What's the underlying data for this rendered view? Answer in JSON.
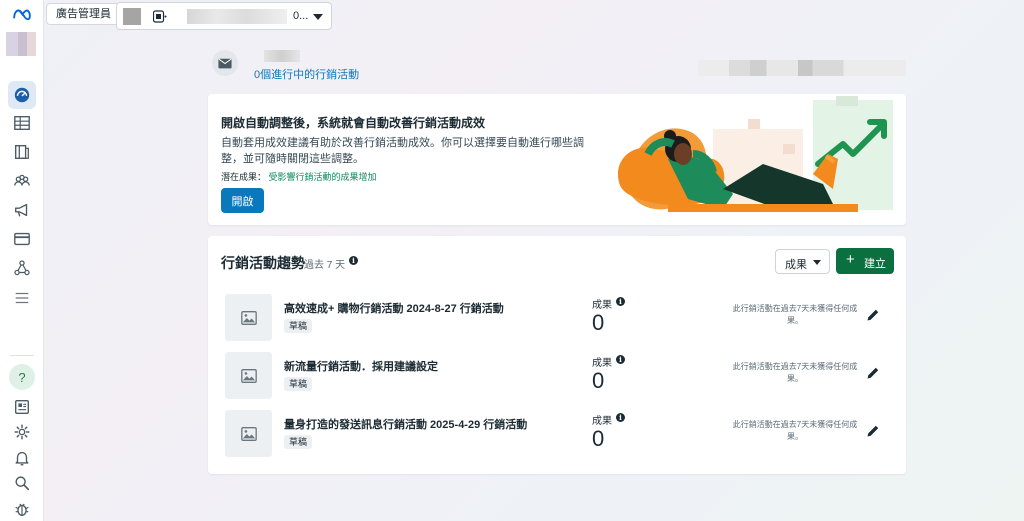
{
  "app": {
    "tooltip": "廣告管理員"
  },
  "account": {
    "name_suffix": "0..."
  },
  "sidebar": {
    "items": [
      {
        "name": "meta-logo-icon"
      },
      {
        "name": "overview-icon"
      },
      {
        "name": "campaigns-table-icon"
      },
      {
        "name": "pages-icon"
      },
      {
        "name": "audiences-icon"
      },
      {
        "name": "megaphone-icon"
      },
      {
        "name": "billing-card-icon"
      },
      {
        "name": "events-icon"
      },
      {
        "name": "menu-icon"
      },
      {
        "name": "help-icon"
      },
      {
        "name": "news-icon"
      },
      {
        "name": "settings-gear-icon"
      },
      {
        "name": "notifications-bell-icon"
      },
      {
        "name": "search-icon"
      },
      {
        "name": "bug-report-icon"
      }
    ]
  },
  "header": {
    "active_campaigns": "0個進行中的行銷活動"
  },
  "promo": {
    "title": "開啟自動調整後，系統就會自動改善行銷活動成效",
    "description": "自動套用成效建議有助於改善行銷活動成效。你可以選擇要自動進行哪些調整，並可隨時關閉這些調整。",
    "potential_label": "潛在成果：",
    "potential_value": "受影響行銷活動的成果增加",
    "button": "開啟"
  },
  "trends": {
    "title": "行銷活動趨勢",
    "period": "過去 7 天",
    "results_dropdown": "成果",
    "create_button": "建立",
    "rows": [
      {
        "name": "高效速成+ 購物行銷活動 2024-8-27 行銷活動",
        "status": "草稿",
        "result_label": "成果",
        "result_value": "0",
        "note": "此行銷活動在過去7天未獲得任何成果。"
      },
      {
        "name": "新流量行銷活動．採用建議設定",
        "status": "草稿",
        "result_label": "成果",
        "result_value": "0",
        "note": "此行銷活動在過去7天未獲得任何成果。"
      },
      {
        "name": "量身打造的發送訊息行銷活動 2025-4-29 行銷活動",
        "status": "草稿",
        "result_label": "成果",
        "result_value": "0",
        "note": "此行銷活動在過去7天未獲得任何成果。"
      }
    ]
  },
  "colors": {
    "primary_blue": "#0a78be",
    "create_green": "#0a7040",
    "accent_green": "#0b8a5a"
  }
}
